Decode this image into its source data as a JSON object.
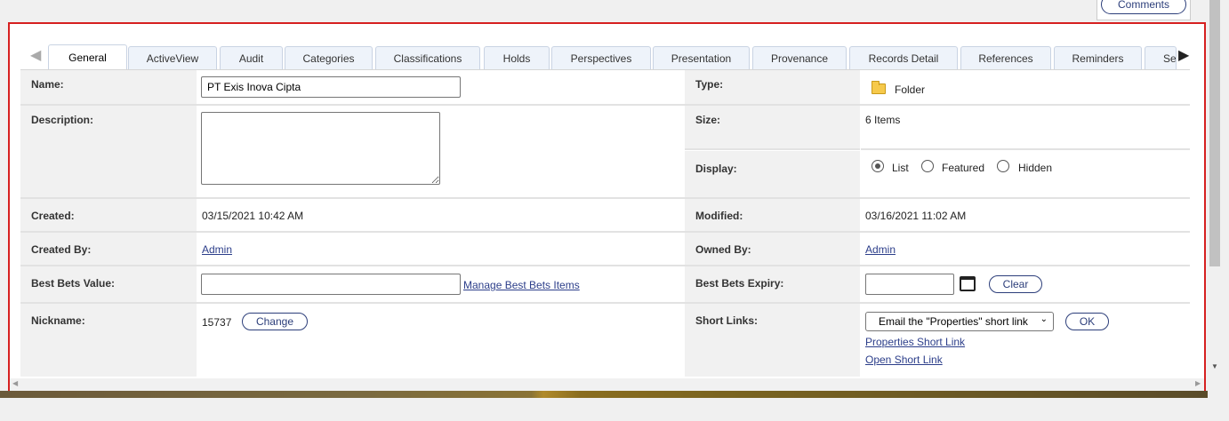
{
  "header": {
    "comments_label": "Comments"
  },
  "tabs": [
    {
      "label": "General",
      "active": true
    },
    {
      "label": "ActiveView"
    },
    {
      "label": "Audit"
    },
    {
      "label": "Categories"
    },
    {
      "label": "Classifications"
    },
    {
      "label": "Holds"
    },
    {
      "label": "Perspectives"
    },
    {
      "label": "Presentation"
    },
    {
      "label": "Provenance"
    },
    {
      "label": "Records Detail"
    },
    {
      "label": "References"
    },
    {
      "label": "Reminders"
    },
    {
      "label": "Se"
    }
  ],
  "fields": {
    "name_label": "Name:",
    "name_value": "PT Exis Inova Cipta",
    "type_label": "Type:",
    "type_value": "Folder",
    "description_label": "Description:",
    "description_value": "",
    "size_label": "Size:",
    "size_value": "6 Items",
    "display_label": "Display:",
    "display_options": [
      "List",
      "Featured",
      "Hidden"
    ],
    "display_selected": "List",
    "created_label": "Created:",
    "created_value": "03/15/2021 10:42 AM",
    "modified_label": "Modified:",
    "modified_value": "03/16/2021 11:02 AM",
    "created_by_label": "Created By:",
    "created_by_value": "Admin",
    "owned_by_label": "Owned By:",
    "owned_by_value": "Admin",
    "best_bets_value_label": "Best Bets Value:",
    "best_bets_value": "",
    "manage_best_bets_link": "Manage Best Bets Items",
    "best_bets_expiry_label": "Best Bets Expiry:",
    "best_bets_expiry_value": "",
    "clear_label": "Clear",
    "nickname_label": "Nickname:",
    "nickname_value": "15737",
    "change_label": "Change",
    "short_links_label": "Short Links:",
    "short_links_selected": "Email the \"Properties\" short link",
    "ok_label": "OK",
    "properties_short_link": "Properties Short Link",
    "open_short_link": "Open Short Link"
  },
  "icons": {
    "type": "folder-icon",
    "calendar": "calendar-icon",
    "tab_prev": "arrow-left-icon",
    "tab_next": "arrow-right-icon",
    "select_chevron": "chevron-down-icon"
  },
  "colors": {
    "frame_border": "#d62020",
    "link": "#2c3e8a",
    "label_bg": "#f1f1f1",
    "folder": "#f6c94b"
  }
}
